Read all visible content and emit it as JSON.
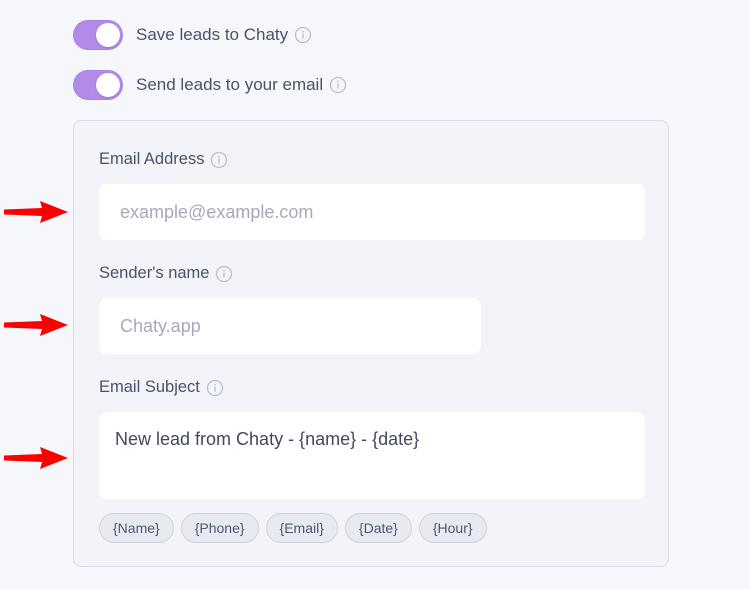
{
  "toggles": [
    {
      "label": "Save leads to Chaty",
      "on": true
    },
    {
      "label": "Send leads to your email",
      "on": true
    }
  ],
  "email_panel": {
    "email_address": {
      "label": "Email Address",
      "placeholder": "example@example.com",
      "value": ""
    },
    "sender_name": {
      "label": "Sender's name",
      "placeholder": "Chaty.app",
      "value": ""
    },
    "email_subject": {
      "label": "Email Subject",
      "value": "New lead from Chaty - {name} - {date}"
    },
    "tags": [
      "{Name}",
      "{Phone}",
      "{Email}",
      "{Date}",
      "{Hour}"
    ]
  },
  "colors": {
    "toggle_on": "#b28be8",
    "annotation_arrow": "#ff0000",
    "panel_bg": "#f2f4f9",
    "info_icon": "#b7c0d0"
  },
  "icons": {
    "info": "info-circle-icon",
    "arrow": "red-arrow-right-icon"
  }
}
